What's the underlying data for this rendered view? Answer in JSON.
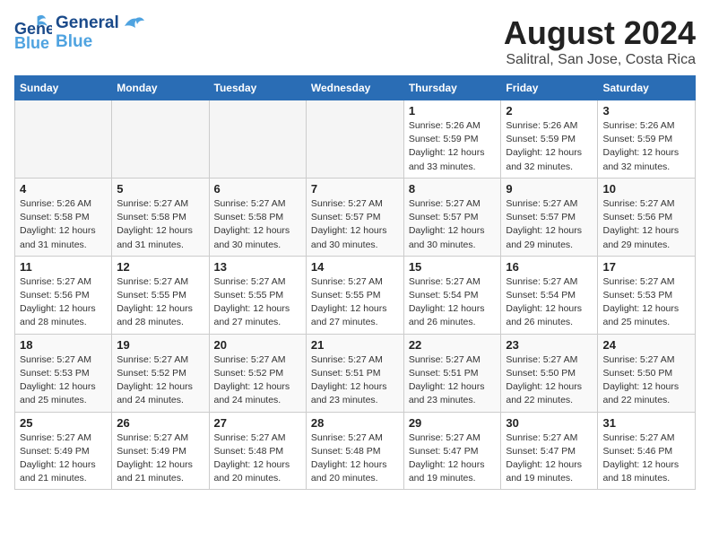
{
  "header": {
    "logo_line1": "General",
    "logo_line2": "Blue",
    "month": "August 2024",
    "location": "Salitral, San Jose, Costa Rica"
  },
  "days_of_week": [
    "Sunday",
    "Monday",
    "Tuesday",
    "Wednesday",
    "Thursday",
    "Friday",
    "Saturday"
  ],
  "weeks": [
    [
      {
        "day": "",
        "info": ""
      },
      {
        "day": "",
        "info": ""
      },
      {
        "day": "",
        "info": ""
      },
      {
        "day": "",
        "info": ""
      },
      {
        "day": "1",
        "info": "Sunrise: 5:26 AM\nSunset: 5:59 PM\nDaylight: 12 hours\nand 33 minutes."
      },
      {
        "day": "2",
        "info": "Sunrise: 5:26 AM\nSunset: 5:59 PM\nDaylight: 12 hours\nand 32 minutes."
      },
      {
        "day": "3",
        "info": "Sunrise: 5:26 AM\nSunset: 5:59 PM\nDaylight: 12 hours\nand 32 minutes."
      }
    ],
    [
      {
        "day": "4",
        "info": "Sunrise: 5:26 AM\nSunset: 5:58 PM\nDaylight: 12 hours\nand 31 minutes."
      },
      {
        "day": "5",
        "info": "Sunrise: 5:27 AM\nSunset: 5:58 PM\nDaylight: 12 hours\nand 31 minutes."
      },
      {
        "day": "6",
        "info": "Sunrise: 5:27 AM\nSunset: 5:58 PM\nDaylight: 12 hours\nand 30 minutes."
      },
      {
        "day": "7",
        "info": "Sunrise: 5:27 AM\nSunset: 5:57 PM\nDaylight: 12 hours\nand 30 minutes."
      },
      {
        "day": "8",
        "info": "Sunrise: 5:27 AM\nSunset: 5:57 PM\nDaylight: 12 hours\nand 30 minutes."
      },
      {
        "day": "9",
        "info": "Sunrise: 5:27 AM\nSunset: 5:57 PM\nDaylight: 12 hours\nand 29 minutes."
      },
      {
        "day": "10",
        "info": "Sunrise: 5:27 AM\nSunset: 5:56 PM\nDaylight: 12 hours\nand 29 minutes."
      }
    ],
    [
      {
        "day": "11",
        "info": "Sunrise: 5:27 AM\nSunset: 5:56 PM\nDaylight: 12 hours\nand 28 minutes."
      },
      {
        "day": "12",
        "info": "Sunrise: 5:27 AM\nSunset: 5:55 PM\nDaylight: 12 hours\nand 28 minutes."
      },
      {
        "day": "13",
        "info": "Sunrise: 5:27 AM\nSunset: 5:55 PM\nDaylight: 12 hours\nand 27 minutes."
      },
      {
        "day": "14",
        "info": "Sunrise: 5:27 AM\nSunset: 5:55 PM\nDaylight: 12 hours\nand 27 minutes."
      },
      {
        "day": "15",
        "info": "Sunrise: 5:27 AM\nSunset: 5:54 PM\nDaylight: 12 hours\nand 26 minutes."
      },
      {
        "day": "16",
        "info": "Sunrise: 5:27 AM\nSunset: 5:54 PM\nDaylight: 12 hours\nand 26 minutes."
      },
      {
        "day": "17",
        "info": "Sunrise: 5:27 AM\nSunset: 5:53 PM\nDaylight: 12 hours\nand 25 minutes."
      }
    ],
    [
      {
        "day": "18",
        "info": "Sunrise: 5:27 AM\nSunset: 5:53 PM\nDaylight: 12 hours\nand 25 minutes."
      },
      {
        "day": "19",
        "info": "Sunrise: 5:27 AM\nSunset: 5:52 PM\nDaylight: 12 hours\nand 24 minutes."
      },
      {
        "day": "20",
        "info": "Sunrise: 5:27 AM\nSunset: 5:52 PM\nDaylight: 12 hours\nand 24 minutes."
      },
      {
        "day": "21",
        "info": "Sunrise: 5:27 AM\nSunset: 5:51 PM\nDaylight: 12 hours\nand 23 minutes."
      },
      {
        "day": "22",
        "info": "Sunrise: 5:27 AM\nSunset: 5:51 PM\nDaylight: 12 hours\nand 23 minutes."
      },
      {
        "day": "23",
        "info": "Sunrise: 5:27 AM\nSunset: 5:50 PM\nDaylight: 12 hours\nand 22 minutes."
      },
      {
        "day": "24",
        "info": "Sunrise: 5:27 AM\nSunset: 5:50 PM\nDaylight: 12 hours\nand 22 minutes."
      }
    ],
    [
      {
        "day": "25",
        "info": "Sunrise: 5:27 AM\nSunset: 5:49 PM\nDaylight: 12 hours\nand 21 minutes."
      },
      {
        "day": "26",
        "info": "Sunrise: 5:27 AM\nSunset: 5:49 PM\nDaylight: 12 hours\nand 21 minutes."
      },
      {
        "day": "27",
        "info": "Sunrise: 5:27 AM\nSunset: 5:48 PM\nDaylight: 12 hours\nand 20 minutes."
      },
      {
        "day": "28",
        "info": "Sunrise: 5:27 AM\nSunset: 5:48 PM\nDaylight: 12 hours\nand 20 minutes."
      },
      {
        "day": "29",
        "info": "Sunrise: 5:27 AM\nSunset: 5:47 PM\nDaylight: 12 hours\nand 19 minutes."
      },
      {
        "day": "30",
        "info": "Sunrise: 5:27 AM\nSunset: 5:47 PM\nDaylight: 12 hours\nand 19 minutes."
      },
      {
        "day": "31",
        "info": "Sunrise: 5:27 AM\nSunset: 5:46 PM\nDaylight: 12 hours\nand 18 minutes."
      }
    ]
  ]
}
